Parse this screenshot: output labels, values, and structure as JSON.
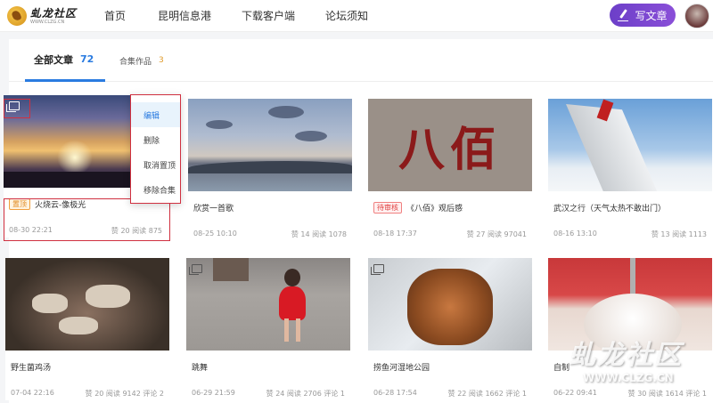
{
  "header": {
    "logo_title": "虬龙社区",
    "logo_sub": "WWW.CLZG.CN",
    "nav": [
      "首页",
      "昆明信息港",
      "下载客户端",
      "论坛须知"
    ],
    "write_label": "写文章"
  },
  "tabs": [
    {
      "label": "全部文章",
      "count": "72"
    },
    {
      "label": "合集作品",
      "count": "3"
    }
  ],
  "context_menu": [
    "编辑",
    "删除",
    "取消置顶",
    "移除合集"
  ],
  "cards": [
    {
      "title": "火烧云-像极光",
      "badge": "置顶",
      "date": "08-30 22:21",
      "stats": "赞 20 阅读 875"
    },
    {
      "title": "欣赏一首歌",
      "badge": "",
      "date": "08-25 10:10",
      "stats": "赞 14 阅读 1078"
    },
    {
      "title": "《八佰》观后感",
      "badge": "待审核",
      "date": "08-18 17:37",
      "stats": "赞 27 阅读 97041"
    },
    {
      "title": "武汉之行（天气太热不敢出门）",
      "badge": "",
      "date": "08-16 13:10",
      "stats": "赞 13 阅读 1113"
    },
    {
      "title": "野生菌鸡汤",
      "badge": "",
      "date": "07-04 22:16",
      "stats": "赞 20 阅读 9142 评论 2"
    },
    {
      "title": "跳舞",
      "badge": "",
      "date": "06-29 21:59",
      "stats": "赞 24 阅读 2706 评论 1"
    },
    {
      "title": "捞鱼河湿地公园",
      "badge": "",
      "date": "06-28 17:54",
      "stats": "赞 22 阅读 1662 评论 1"
    },
    {
      "title": "自制",
      "badge": "",
      "date": "06-22 09:41",
      "stats": "赞 30 阅读 1614 评论 1"
    }
  ],
  "thumb_text": {
    "wall": "八佰",
    "wall_tag": "八佰"
  },
  "watermark": {
    "title": "虬龙社区",
    "url": "WWW.CLZG.CN"
  },
  "colors": {
    "accent": "#2a7be0",
    "write_button": "#7a45d0",
    "selection": "#d03040",
    "pinned_badge": "#e08a20",
    "review_badge": "#e04040"
  }
}
